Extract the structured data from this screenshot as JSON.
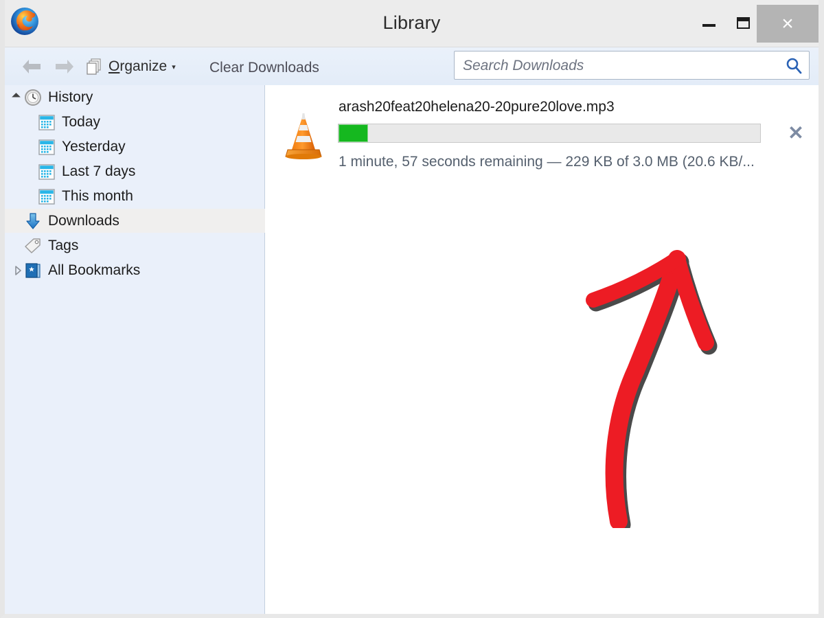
{
  "window": {
    "title": "Library",
    "logo_icon": "firefox-logo",
    "controls": {
      "minimize_label": "–",
      "maximize_label": "❐",
      "close_label": "×",
      "close_bg": "#b4b4b4"
    }
  },
  "toolbar": {
    "back_icon": "back-arrow-icon",
    "forward_icon": "forward-arrow-icon",
    "organize_icon": "stacked-pages-icon",
    "organize_label_accel": "O",
    "organize_label_rest": "rganize",
    "organize_caret": "▾",
    "clear_downloads_label": "Clear Downloads"
  },
  "search": {
    "placeholder": "Search Downloads",
    "value": "",
    "icon": "search-icon",
    "icon_color": "#2a62b5"
  },
  "sidebar": {
    "selected_bg": "#f0efee",
    "background": "#eaf0fa",
    "items": [
      {
        "label": "History",
        "icon": "clock-icon",
        "indent": 0,
        "expander": "open",
        "selected": false
      },
      {
        "label": "Today",
        "icon": "calendar-icon",
        "indent": 1,
        "expander": "none",
        "selected": false
      },
      {
        "label": "Yesterday",
        "icon": "calendar-icon",
        "indent": 1,
        "expander": "none",
        "selected": false
      },
      {
        "label": "Last 7 days",
        "icon": "calendar-icon",
        "indent": 1,
        "expander": "none",
        "selected": false
      },
      {
        "label": "This month",
        "icon": "calendar-icon",
        "indent": 1,
        "expander": "none",
        "selected": false
      },
      {
        "label": "Downloads",
        "icon": "download-arrow-icon",
        "indent": 0,
        "expander": "none",
        "selected": true
      },
      {
        "label": "Tags",
        "icon": "tag-icon",
        "indent": 0,
        "expander": "none",
        "selected": false
      },
      {
        "label": "All Bookmarks",
        "icon": "bookmarks-book-icon",
        "indent": 0,
        "expander": "closed",
        "selected": false
      }
    ]
  },
  "download": {
    "file_icon": "vlc-cone-icon",
    "filename": "arash20feat20helena20-20pure20love.mp3",
    "status": "1 minute, 57 seconds remaining — 229 KB of 3.0 MB (20.6 KB/...",
    "progress_percent": 7,
    "progress_fill_color": "#15b81f",
    "progress_track_color": "#e9e9e9",
    "cancel_label": "✕"
  },
  "annotation": {
    "type": "hand-drawn-arrow",
    "color": "#ed1c24",
    "shadow_color": "#4a4a4a",
    "points_to": "download-progress-bar"
  }
}
